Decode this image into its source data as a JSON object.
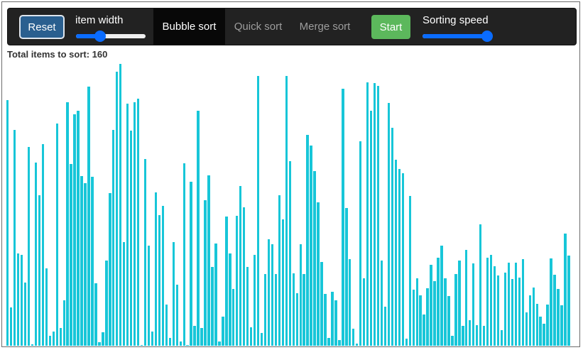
{
  "toolbar": {
    "reset_label": "Reset",
    "item_width_label": "item width",
    "item_width_value": 0.35,
    "tabs": [
      {
        "label": "Bubble sort",
        "active": true
      },
      {
        "label": "Quick sort",
        "active": false
      },
      {
        "label": "Merge sort",
        "active": false
      }
    ],
    "start_label": "Start",
    "speed_label": "Sorting speed",
    "speed_value": 0.93
  },
  "status": {
    "total_text": "Total items to sort: 160"
  },
  "colors": {
    "bar": "#17c6d8",
    "toolbar_bg": "#222222",
    "start_button": "#5cb85c",
    "reset_button": "#2a5f8f",
    "slider_accent": "#0a6cff"
  },
  "items": [
    346,
    54,
    304,
    130,
    128,
    89,
    280,
    2,
    258,
    212,
    284,
    109,
    14,
    20,
    313,
    25,
    64,
    343,
    256,
    326,
    331,
    239,
    229,
    365,
    238,
    88,
    5,
    19,
    120,
    215,
    304,
    386,
    397,
    146,
    341,
    303,
    343,
    348,
    1,
    263,
    141,
    20,
    216,
    184,
    197,
    58,
    11,
    146,
    86,
    6,
    257,
    1,
    231,
    28,
    331,
    25,
    205,
    240,
    111,
    144,
    6,
    41,
    182,
    130,
    80,
    183,
    225,
    195,
    111,
    26,
    128,
    380,
    18,
    101,
    150,
    143,
    101,
    212,
    178,
    380,
    260,
    102,
    74,
    143,
    101,
    297,
    282,
    246,
    202,
    118,
    73,
    11,
    76,
    64,
    8,
    362,
    194,
    122,
    24,
    3,
    288,
    95,
    371,
    331,
    370,
    366,
    120,
    55,
    342,
    307,
    262,
    249,
    243,
    10,
    211,
    79,
    95,
    71,
    44,
    81,
    114,
    91,
    124,
    141,
    95,
    70,
    14,
    101,
    120,
    28,
    135,
    36,
    116,
    29,
    171,
    28,
    124,
    128,
    112,
    99,
    22,
    103,
    117,
    94,
    117,
    96,
    122,
    47,
    71,
    82,
    59,
    41,
    31,
    58,
    123,
    100,
    80,
    57,
    158,
    127
  ]
}
